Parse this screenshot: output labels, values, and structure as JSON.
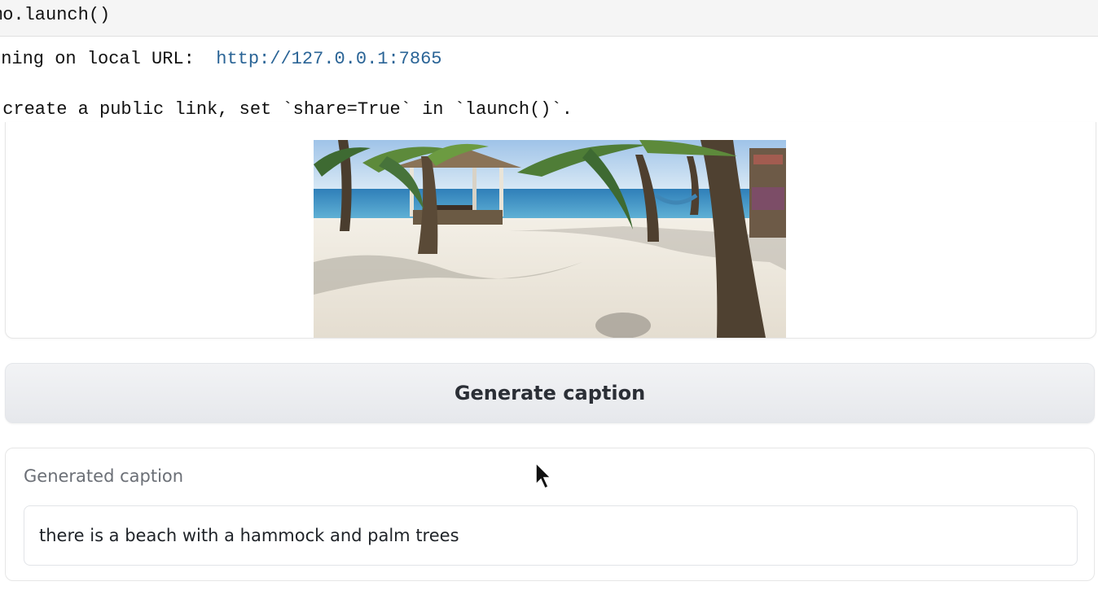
{
  "code": {
    "line": "mo.launch()"
  },
  "output": {
    "line1_prefix": "nning on local URL:  ",
    "line1_url": "http://127.0.0.1:7865",
    "line2": " create a public link, set `share=True` in `launch()`."
  },
  "button": {
    "label": "Generate caption"
  },
  "caption": {
    "label": "Generated caption",
    "value": "there is a beach with a hammock and palm trees"
  }
}
